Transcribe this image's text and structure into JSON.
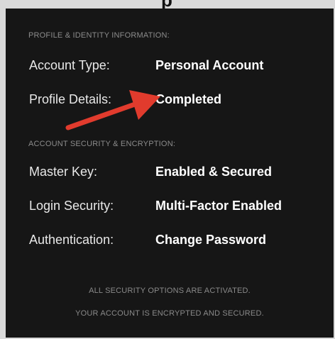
{
  "partial_heading": "p",
  "profile_section": {
    "title": "PROFILE & IDENTITY INFORMATION:",
    "rows": [
      {
        "label": "Account Type:",
        "value": "Personal Account"
      },
      {
        "label": "Profile Details:",
        "value": "Completed"
      }
    ]
  },
  "security_section": {
    "title": "ACCOUNT SECURITY & ENCRYPTION:",
    "rows": [
      {
        "label": "Master Key:",
        "value": "Enabled & Secured"
      },
      {
        "label": "Login Security:",
        "value": "Multi-Factor Enabled"
      },
      {
        "label": "Authentication:",
        "value": "Change Password"
      }
    ]
  },
  "footer": {
    "line1": "ALL SECURITY OPTIONS ARE ACTIVATED.",
    "line2": "YOUR ACCOUNT IS ENCRYPTED AND SECURED."
  },
  "colors": {
    "panel_background": "#161616",
    "arrow": "#e13b2d",
    "muted_text": "#8c8c8c"
  },
  "annotation": {
    "icon": "red-arrow-icon"
  }
}
